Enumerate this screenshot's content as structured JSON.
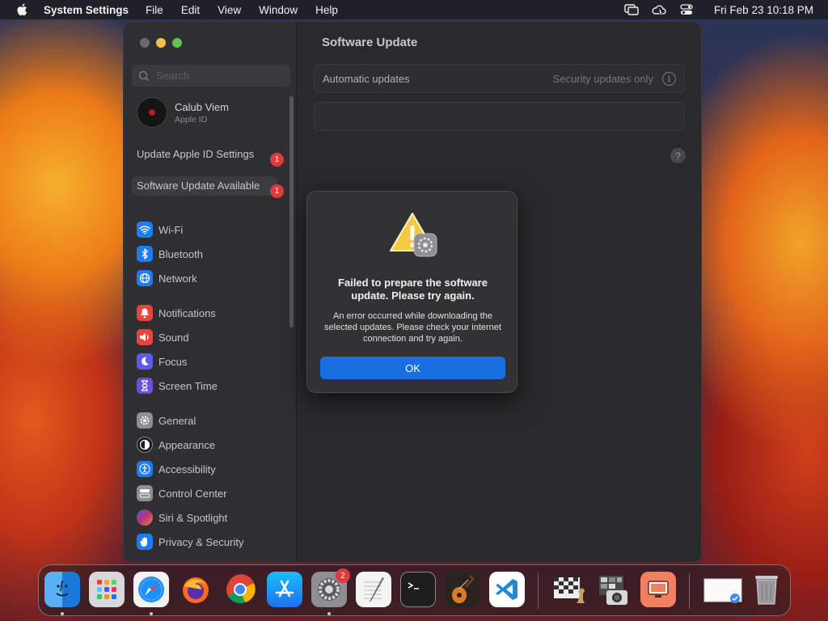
{
  "menubar": {
    "app_name": "System Settings",
    "menus": [
      "File",
      "Edit",
      "View",
      "Window",
      "Help"
    ],
    "clock": "Fri Feb 23  10:18 PM"
  },
  "sidebar": {
    "search_placeholder": "Search",
    "profile": {
      "name": "Calub Viem",
      "subtitle": "Apple ID"
    },
    "notices": [
      {
        "label": "Update Apple ID Settings",
        "badge": "1"
      },
      {
        "label": "Software Update Available",
        "badge": "1"
      }
    ],
    "items": [
      {
        "label": "Wi-Fi",
        "icon": "wifi-icon",
        "color": "#1f7cf0"
      },
      {
        "label": "Bluetooth",
        "icon": "bluetooth-icon",
        "color": "#1f7cf0"
      },
      {
        "label": "Network",
        "icon": "globe-icon",
        "color": "#1f7cf0"
      },
      {
        "label": "Notifications",
        "icon": "bell-icon",
        "color": "#e5453c"
      },
      {
        "label": "Sound",
        "icon": "speaker-icon",
        "color": "#e5453c"
      },
      {
        "label": "Focus",
        "icon": "moon-icon",
        "color": "#5e5ce6"
      },
      {
        "label": "Screen Time",
        "icon": "hourglass-icon",
        "color": "#6b4fd8"
      },
      {
        "label": "General",
        "icon": "gear-icon",
        "color": "#8e8e93"
      },
      {
        "label": "Appearance",
        "icon": "appearance-icon",
        "color": "#1c1c1e"
      },
      {
        "label": "Accessibility",
        "icon": "accessibility-icon",
        "color": "#1f7cf0"
      },
      {
        "label": "Control Center",
        "icon": "control-center-icon",
        "color": "#8e8e93"
      },
      {
        "label": "Siri & Spotlight",
        "icon": "siri-icon",
        "color": "#b0307a"
      },
      {
        "label": "Privacy & Security",
        "icon": "hand-icon",
        "color": "#1f7cf0"
      }
    ]
  },
  "content": {
    "title": "Software Update",
    "automatic_updates_label": "Automatic updates",
    "automatic_updates_value": "Security updates only",
    "help_label": "?"
  },
  "dialog": {
    "title": "Failed to prepare the software update. Please try again.",
    "message": "An error occurred while downloading the selected updates. Please check your internet connection and try again.",
    "ok_label": "OK"
  },
  "dock": {
    "settings_badge": "2",
    "apps": [
      "finder-icon",
      "launchpad-icon",
      "safari-icon",
      "firefox-icon",
      "chrome-icon",
      "app-store-icon",
      "system-settings-icon",
      "textedit-icon",
      "terminal-icon",
      "garageband-icon",
      "vscode-icon",
      "chess-icon",
      "image-capture-icon",
      "screen-sharing-icon",
      "desktop-preview-icon",
      "trash-icon"
    ]
  }
}
